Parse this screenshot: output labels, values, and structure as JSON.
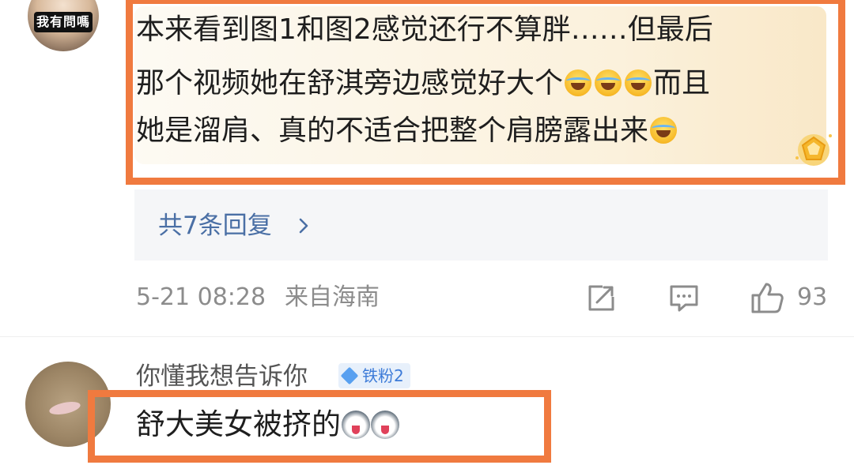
{
  "comment1": {
    "avatar_text": "我有問嗎",
    "lines": [
      "本来看到图1和图2感觉还行不算胖……但最后",
      "那个视频她在舒淇旁边感觉好大个",
      "而且",
      "她是溜肩、真的不适合把整个肩膀露出来"
    ],
    "emoji_name": "laugh-cry-emoji",
    "replies_label": "共7条回复",
    "time": "5-21 08:28",
    "location": "来自海南",
    "like_count": "93"
  },
  "comment2": {
    "username": "你懂我想告诉你",
    "fan_badge": "铁粉2",
    "text": "舒大美女被挤的",
    "emoji_name": "husky-emoji"
  },
  "colors": {
    "highlight": "#f07a3f",
    "link": "#4a6fa5",
    "meta": "#8c8c8c",
    "badge": "#3d7bd8"
  }
}
